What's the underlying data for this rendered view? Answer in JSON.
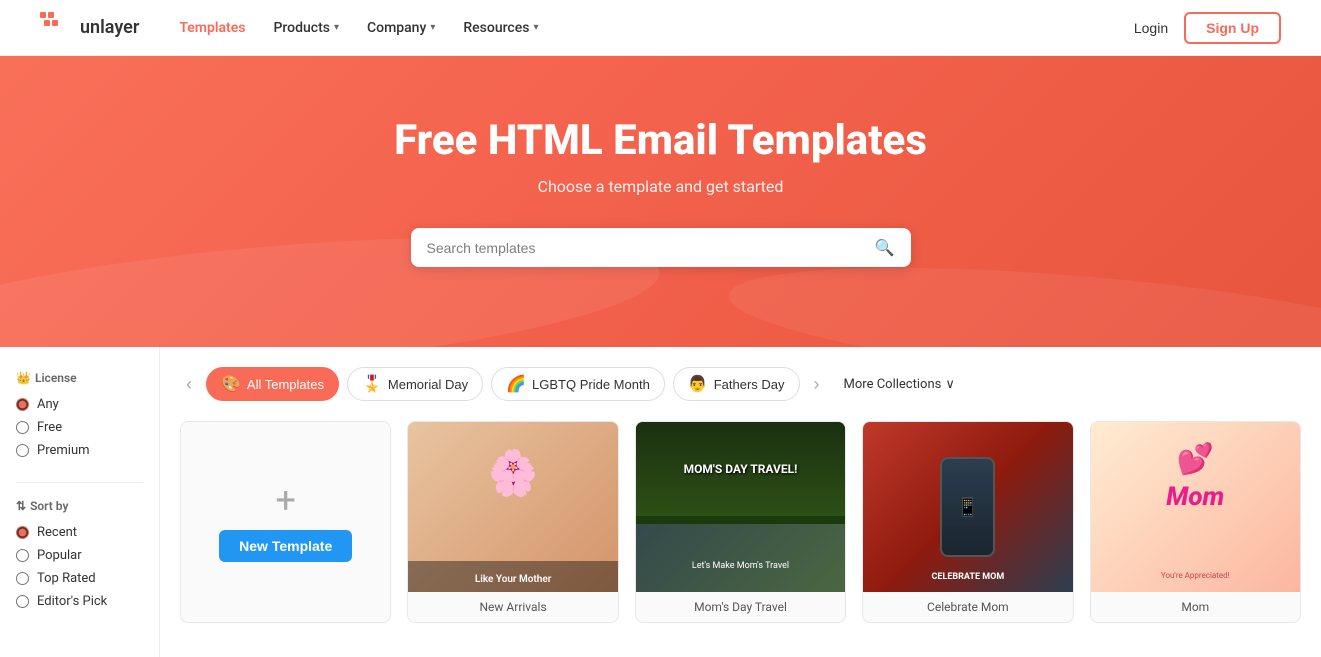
{
  "navbar": {
    "logo_text": "unlayer",
    "nav_items": [
      {
        "label": "Templates",
        "active": true,
        "has_dropdown": false
      },
      {
        "label": "Products",
        "active": false,
        "has_dropdown": true
      },
      {
        "label": "Company",
        "active": false,
        "has_dropdown": true
      },
      {
        "label": "Resources",
        "active": false,
        "has_dropdown": true
      }
    ],
    "login_label": "Login",
    "signup_label": "Sign Up"
  },
  "hero": {
    "title": "Free HTML Email Templates",
    "subtitle": "Choose a template and get started",
    "search_placeholder": "Search templates"
  },
  "sidebar": {
    "license_label": "License",
    "license_icon": "👑",
    "license_options": [
      {
        "label": "Any",
        "checked": true
      },
      {
        "label": "Free",
        "checked": false
      },
      {
        "label": "Premium",
        "checked": false
      }
    ],
    "sort_label": "Sort by",
    "sort_icon": "⇅",
    "sort_options": [
      {
        "label": "Recent",
        "checked": true
      },
      {
        "label": "Popular",
        "checked": false
      },
      {
        "label": "Top Rated",
        "checked": false
      },
      {
        "label": "Editor's Pick",
        "checked": false
      }
    ]
  },
  "collections": {
    "prev_label": "‹",
    "next_label": "›",
    "items": [
      {
        "label": "All Templates",
        "active": true,
        "icon": "🎨"
      },
      {
        "label": "Memorial Day",
        "active": false,
        "icon": "🎖️"
      },
      {
        "label": "LGBTQ Pride Month",
        "active": false,
        "icon": "🌈"
      },
      {
        "label": "Fathers Day",
        "active": false,
        "icon": "👨"
      }
    ],
    "more_label": "More Collections",
    "more_icon": "∨"
  },
  "templates": {
    "new_template_label": "New Template",
    "cards": [
      {
        "id": "new",
        "type": "new"
      },
      {
        "id": "t1",
        "type": "thumb",
        "premium": true,
        "thumb": "1",
        "label": "New Arrivals"
      },
      {
        "id": "t2",
        "type": "thumb",
        "premium": true,
        "thumb": "2",
        "label": "Mom's Day Travel"
      },
      {
        "id": "t3",
        "type": "thumb",
        "premium": false,
        "thumb": "3",
        "label": "Celebrate Mom"
      },
      {
        "id": "t4",
        "type": "thumb",
        "premium": false,
        "thumb": "4",
        "label": "Mom"
      }
    ]
  }
}
